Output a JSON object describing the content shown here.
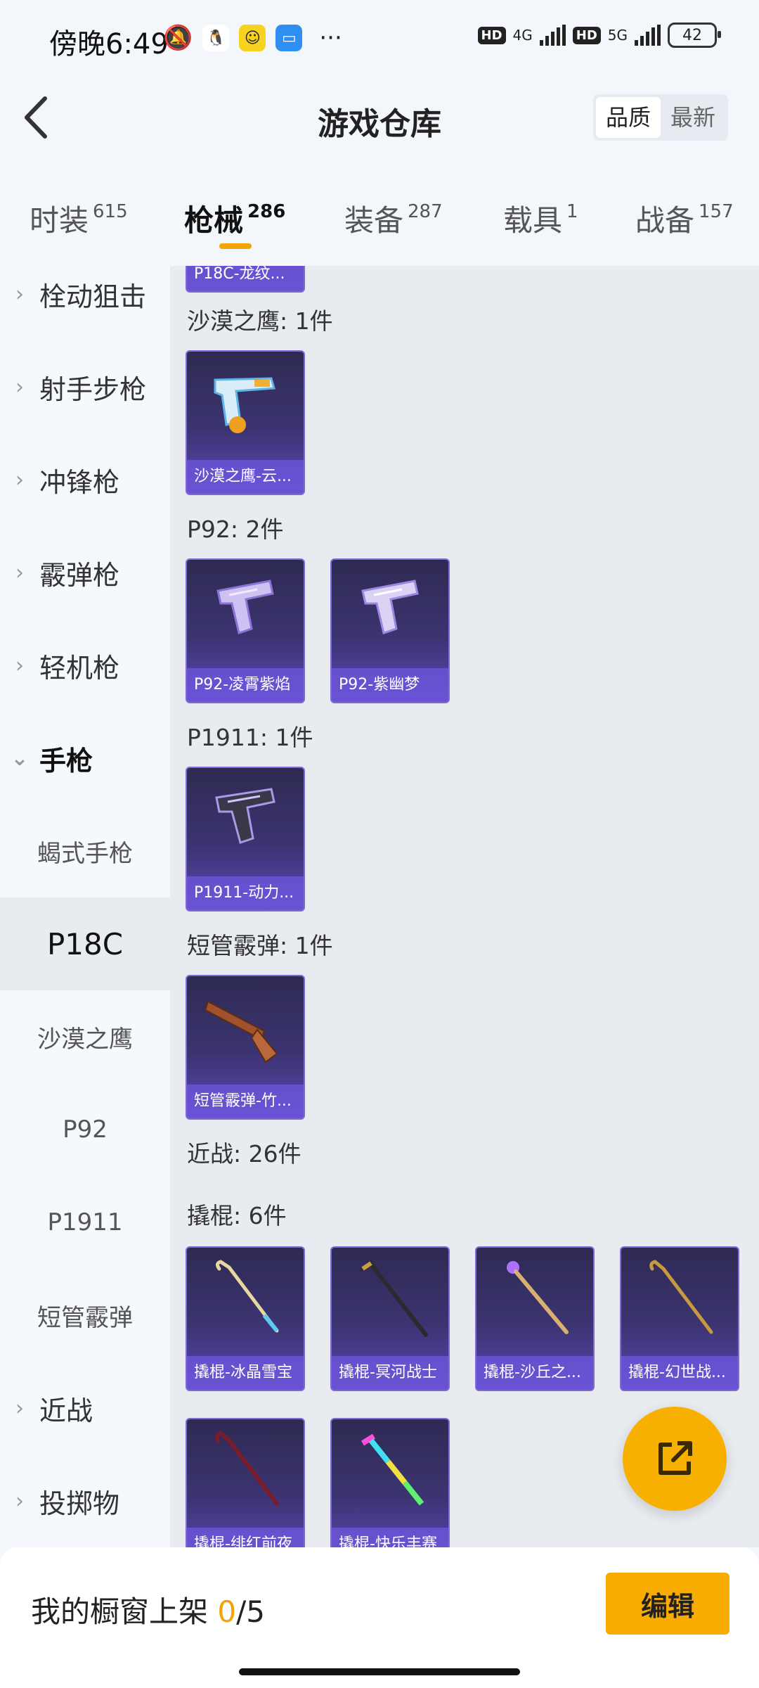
{
  "status_bar": {
    "time": "傍晚6:49",
    "more": "···",
    "network_1": "4G",
    "network_2": "5G",
    "hd": "HD",
    "battery": "42"
  },
  "header": {
    "title": "游戏仓库",
    "sort_quality": "品质",
    "sort_latest": "最新"
  },
  "tabs": [
    {
      "label": "时装",
      "count": "615"
    },
    {
      "label": "枪械",
      "count": "286"
    },
    {
      "label": "装备",
      "count": "287"
    },
    {
      "label": "载具",
      "count": "1"
    },
    {
      "label": "战备",
      "count": "157"
    }
  ],
  "sidebar": {
    "categories": [
      "栓动狙击",
      "射手步枪",
      "冲锋枪",
      "霰弹枪",
      "轻机枪",
      "手枪"
    ],
    "pistol_subs": [
      "蝎式手枪",
      "P18C",
      "沙漠之鹰",
      "P92",
      "P1911",
      "短管霰弹"
    ],
    "more_categories": [
      "近战",
      "投掷物"
    ]
  },
  "content": {
    "top_partial_label": "P18C-龙纹...",
    "groups": [
      {
        "label": "沙漠之鹰: 1件",
        "items": [
          "沙漠之鹰-云..."
        ]
      },
      {
        "label": "P92: 2件",
        "items": [
          "P92-凌霄紫焰",
          "P92-紫幽梦"
        ]
      },
      {
        "label": "P1911: 1件",
        "items": [
          "P1911-动力..."
        ]
      },
      {
        "label": "短管霰弹: 1件",
        "items": [
          "短管霰弹-竹..."
        ]
      }
    ],
    "melee_label": "近战: 26件",
    "crowbar_label": "撬棍: 6件",
    "crowbars": [
      "撬棍-冰晶雪宝",
      "撬棍-冥河战士",
      "撬棍-沙丘之...",
      "撬棍-幻世战...",
      "撬棍-绯红前夜",
      "撬棍-快乐丰赛"
    ]
  },
  "bottom": {
    "shelf_label": "我的橱窗上架 ",
    "shelf_count": "0",
    "shelf_total": "/5",
    "edit_label": "编辑"
  },
  "colors": {
    "accent": "#f8ab00",
    "card_border": "#7e6bd8"
  }
}
